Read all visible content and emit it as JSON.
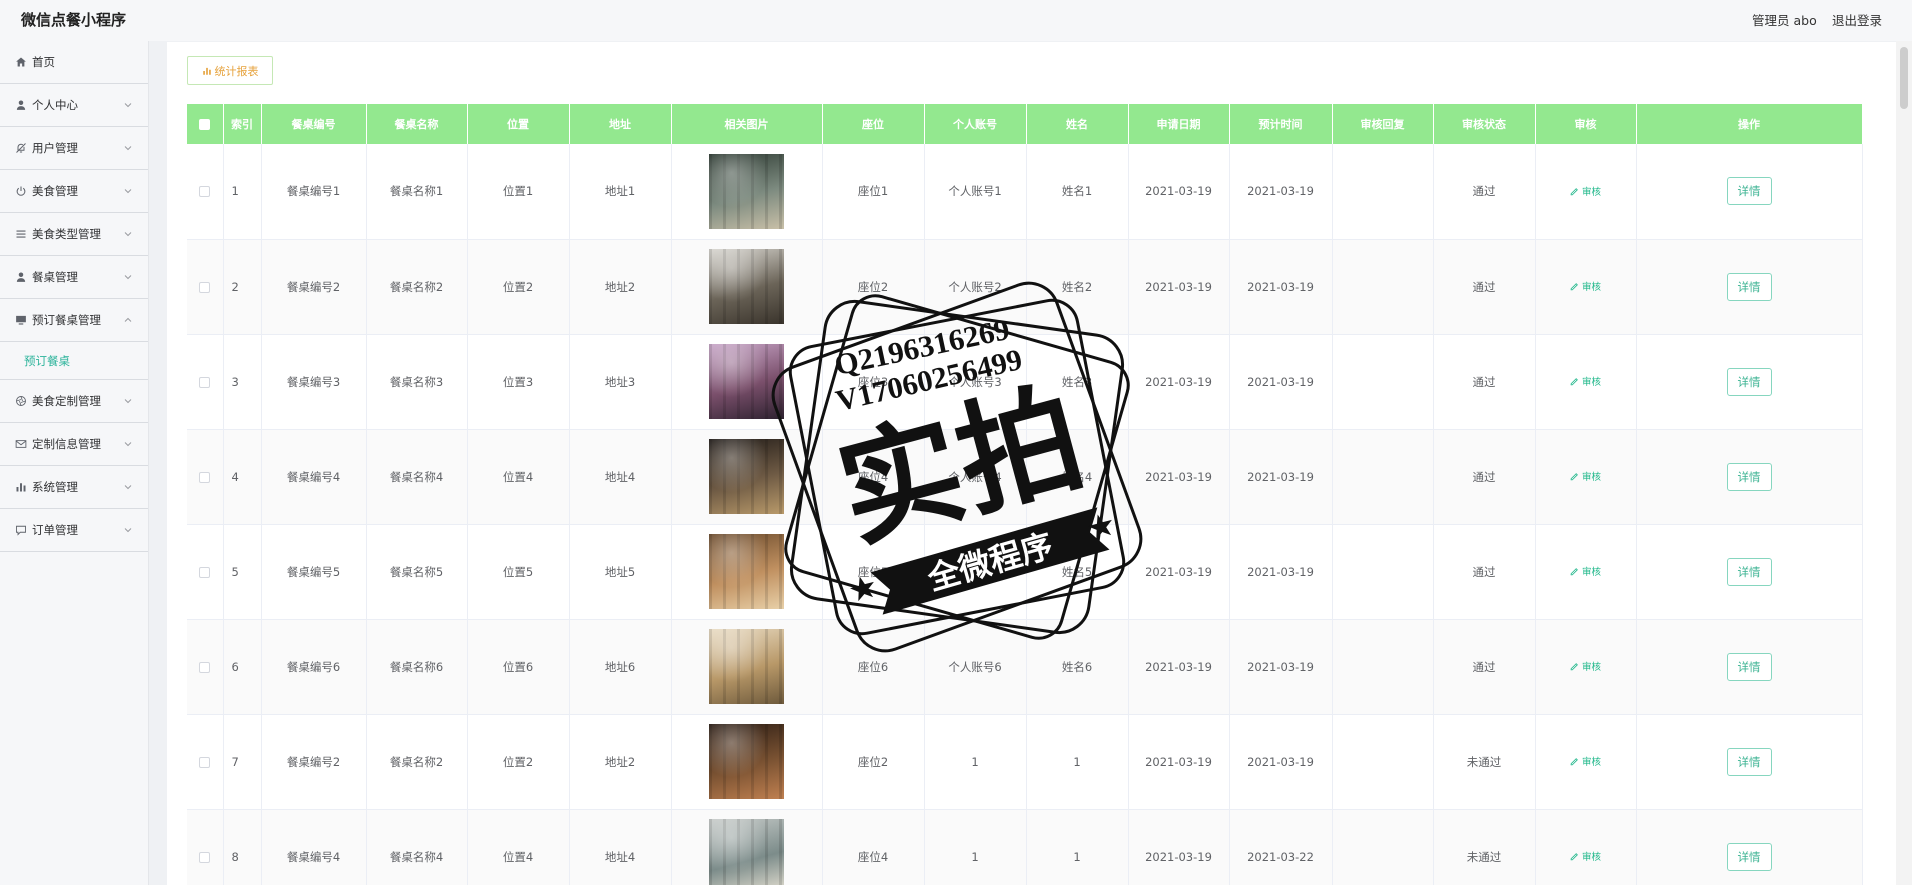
{
  "app": {
    "title": "微信点餐小程序"
  },
  "header": {
    "user_label": "管理员 abo",
    "logout_label": "退出登录"
  },
  "colors": {
    "header_green": "#93e88f",
    "accent_teal": "#2bb39a",
    "warning": "#e6a23c"
  },
  "sidebar": {
    "items": [
      {
        "label": "首页",
        "icon": "home-icon"
      },
      {
        "label": "个人中心",
        "icon": "user-icon"
      },
      {
        "label": "用户管理",
        "icon": "bell-off-icon"
      },
      {
        "label": "美食管理",
        "icon": "power-icon"
      },
      {
        "label": "美食类型管理",
        "icon": "menu-icon"
      },
      {
        "label": "餐桌管理",
        "icon": "user-icon"
      },
      {
        "label": "预订餐桌管理",
        "icon": "monitor-icon",
        "expanded": true,
        "children": [
          {
            "label": "预订餐桌",
            "active": true
          }
        ]
      },
      {
        "label": "美食定制管理",
        "icon": "aperture-icon"
      },
      {
        "label": "定制信息管理",
        "icon": "envelope-icon"
      },
      {
        "label": "系统管理",
        "icon": "bar-chart-icon"
      },
      {
        "label": "订单管理",
        "icon": "chat-icon"
      }
    ]
  },
  "toolbar": {
    "report_button_label": "统计报表",
    "report_icon": "bar-chart-icon"
  },
  "table": {
    "columns": [
      {
        "key": "index",
        "label": "索引"
      },
      {
        "key": "table_no",
        "label": "餐桌编号"
      },
      {
        "key": "table_name",
        "label": "餐桌名称"
      },
      {
        "key": "position",
        "label": "位置"
      },
      {
        "key": "address",
        "label": "地址"
      },
      {
        "key": "image",
        "label": "相关图片"
      },
      {
        "key": "seat",
        "label": "座位"
      },
      {
        "key": "account",
        "label": "个人账号"
      },
      {
        "key": "name",
        "label": "姓名"
      },
      {
        "key": "apply_date",
        "label": "申请日期"
      },
      {
        "key": "expected_time",
        "label": "预计时间"
      },
      {
        "key": "reply",
        "label": "审核回复"
      },
      {
        "key": "status",
        "label": "审核状态"
      },
      {
        "key": "audit",
        "label": "审核"
      },
      {
        "key": "action",
        "label": "操作"
      }
    ],
    "row_actions": {
      "audit_label": "审核",
      "detail_label": "详情"
    },
    "rows": [
      {
        "index": "1",
        "table_no": "餐桌编号1",
        "table_name": "餐桌名称1",
        "position": "位置1",
        "address": "地址1",
        "image_colors": [
          "#2d3a32",
          "#7c8a7f",
          "#c9c0a8"
        ],
        "seat": "座位1",
        "account": "个人账号1",
        "name": "姓名1",
        "apply_date": "2021-03-19",
        "expected_time": "2021-03-19",
        "status": "通过"
      },
      {
        "index": "2",
        "table_no": "餐桌编号2",
        "table_name": "餐桌名称2",
        "position": "位置2",
        "address": "地址2",
        "image_colors": [
          "#d8d6d0",
          "#6b6458",
          "#3a342c"
        ],
        "seat": "座位2",
        "account": "个人账号2",
        "name": "姓名2",
        "apply_date": "2021-03-19",
        "expected_time": "2021-03-19",
        "status": "通过"
      },
      {
        "index": "3",
        "table_no": "餐桌编号3",
        "table_name": "餐桌名称3",
        "position": "位置3",
        "address": "地址3",
        "image_colors": [
          "#c8a6c8",
          "#7a4f6b",
          "#2e2230"
        ],
        "seat": "座位3",
        "account": "个人账号3",
        "name": "姓名3",
        "apply_date": "2021-03-19",
        "expected_time": "2021-03-19",
        "status": "通过"
      },
      {
        "index": "4",
        "table_no": "餐桌编号4",
        "table_name": "餐桌名称4",
        "position": "位置4",
        "address": "地址4",
        "image_colors": [
          "#1f1a17",
          "#6e5a44",
          "#b99a6a"
        ],
        "seat": "座位4",
        "account": "个人账号4",
        "name": "姓名4",
        "apply_date": "2021-03-19",
        "expected_time": "2021-03-19",
        "status": "通过"
      },
      {
        "index": "5",
        "table_no": "餐桌编号5",
        "table_name": "餐桌名称5",
        "position": "位置5",
        "address": "地址5",
        "image_colors": [
          "#6a4a2c",
          "#c09060",
          "#e8d0a8"
        ],
        "seat": "座位5",
        "account": "个人账号5",
        "name": "姓名5",
        "apply_date": "2021-03-19",
        "expected_time": "2021-03-19",
        "status": "通过"
      },
      {
        "index": "6",
        "table_no": "餐桌编号6",
        "table_name": "餐桌名称6",
        "position": "位置6",
        "address": "地址6",
        "image_colors": [
          "#e9dcc4",
          "#b89868",
          "#6e5a3c"
        ],
        "seat": "座位6",
        "account": "个人账号6",
        "name": "姓名6",
        "apply_date": "2021-03-19",
        "expected_time": "2021-03-19",
        "status": "通过"
      },
      {
        "index": "7",
        "table_no": "餐桌编号2",
        "table_name": "餐桌名称2",
        "position": "位置2",
        "address": "地址2",
        "image_colors": [
          "#2a1c14",
          "#7a5232",
          "#c08050"
        ],
        "seat": "座位2",
        "account": "1",
        "name": "1",
        "apply_date": "2021-03-19",
        "expected_time": "2021-03-19",
        "status": "未通过"
      },
      {
        "index": "8",
        "table_no": "餐桌编号4",
        "table_name": "餐桌名称4",
        "position": "位置4",
        "address": "地址4",
        "image_colors": [
          "#c8ccca",
          "#7c8c8a",
          "#e8e2d4"
        ],
        "seat": "座位4",
        "account": "1",
        "name": "1",
        "apply_date": "2021-03-19",
        "expected_time": "2021-03-22",
        "status": "未通过"
      }
    ]
  },
  "watermark": {
    "line1": "Q2196316269",
    "line2": "V17060256499",
    "big_text": "实拍",
    "banner_text": "全微程序"
  }
}
